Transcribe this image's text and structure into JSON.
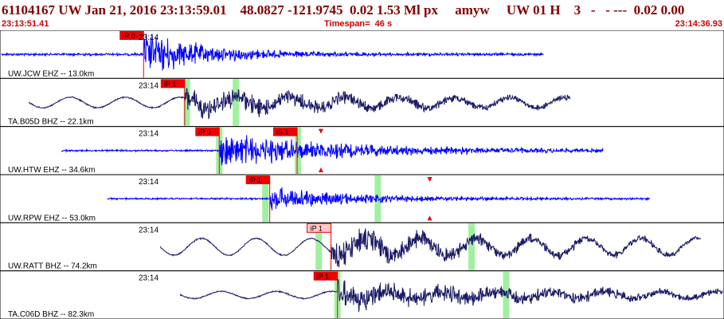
{
  "header": {
    "title": "61104167 UW Jan 21, 2016 23:13:59.01    48.0827 -121.9745  0.02 1.53 Ml px     amyw     UW 01 H    3   -   - ---  0.02 0.00",
    "start_time": "23:13:51.41",
    "timespan": "Timespan=  46 s",
    "end_time": "23:14:36.93"
  },
  "colors": {
    "title": "#800000",
    "accent": "#cc0000",
    "short_period": "#0000ff",
    "broadband": "#1a1a66",
    "pick": "#ee0000",
    "pick_light": "#ffc8c8",
    "window": "#a0f0a0"
  },
  "traces": [
    {
      "label": "UW.JCW EHZ -- 13.0km",
      "tick": "23:14",
      "type": "short_period",
      "picks": [
        {
          "text": "iP 0",
          "t": 0.197,
          "light": false
        }
      ],
      "windows": [],
      "start": 0.0,
      "onset": 0.197,
      "end": 0.752,
      "amp": 1.0,
      "noise": 0.06,
      "decay": 0.16,
      "freq": 0.9,
      "clip": true
    },
    {
      "label": "TA.B05D BHZ -- 22.1km",
      "tick": "23:14",
      "type": "broadband",
      "picks": [
        {
          "text": "iP 1",
          "t": 0.254,
          "light": false
        }
      ],
      "windows": [
        0.257,
        0.325
      ],
      "start": 0.038,
      "onset": 0.254,
      "end": 0.789,
      "amp": 0.55,
      "noise": 0.03,
      "decay": 0.55,
      "freq": 0.7,
      "wave": 0.22
    },
    {
      "label": "UW.HTW EHZ -- 34.6km",
      "tick": "23:14",
      "type": "short_period",
      "picks": [
        {
          "text": "iP 0",
          "t": 0.302,
          "light": false
        },
        {
          "text": "iS 1",
          "t": 0.41,
          "light": false
        }
      ],
      "windows": [
        0.302,
        0.411
      ],
      "markers": [
        0.443
      ],
      "start": 0.083,
      "onset": 0.302,
      "end": 0.835,
      "amp": 0.75,
      "noise": 0.04,
      "decay": 0.35,
      "freq": 1.0
    },
    {
      "label": "UW.RPW EHZ -- 53.0km",
      "tick": "23:14",
      "type": "short_period",
      "picks": [
        {
          "text": "iP 1",
          "t": 0.372,
          "light": false
        }
      ],
      "windows": [
        0.366,
        0.522
      ],
      "markers": [
        0.594
      ],
      "start": 0.147,
      "onset": 0.372,
      "end": 0.9,
      "amp": 0.55,
      "noise": 0.04,
      "decay": 0.22,
      "freq": 1.0
    },
    {
      "label": "UW.RATT BHZ -- 74.2km",
      "tick": "23:14",
      "type": "broadband",
      "picks": [
        {
          "text": "iP 1",
          "t": 0.457,
          "light": true
        }
      ],
      "windows": [
        0.44,
        0.652
      ],
      "start": 0.22,
      "onset": 0.457,
      "end": 0.97,
      "amp": 0.6,
      "noise": 0.03,
      "decay": 0.5,
      "freq": 0.7,
      "wave": 0.35
    },
    {
      "label": "TA.C06D BHZ -- 82.3km",
      "tick": "23:14",
      "type": "broadband",
      "picks": [
        {
          "text": "iP 1",
          "t": 0.466,
          "light": false
        }
      ],
      "windows": [
        0.466,
        0.7
      ],
      "start": 0.248,
      "onset": 0.466,
      "end": 1.0,
      "amp": 0.6,
      "noise": 0.03,
      "decay": 0.6,
      "freq": 0.7,
      "wave": 0.15
    }
  ]
}
